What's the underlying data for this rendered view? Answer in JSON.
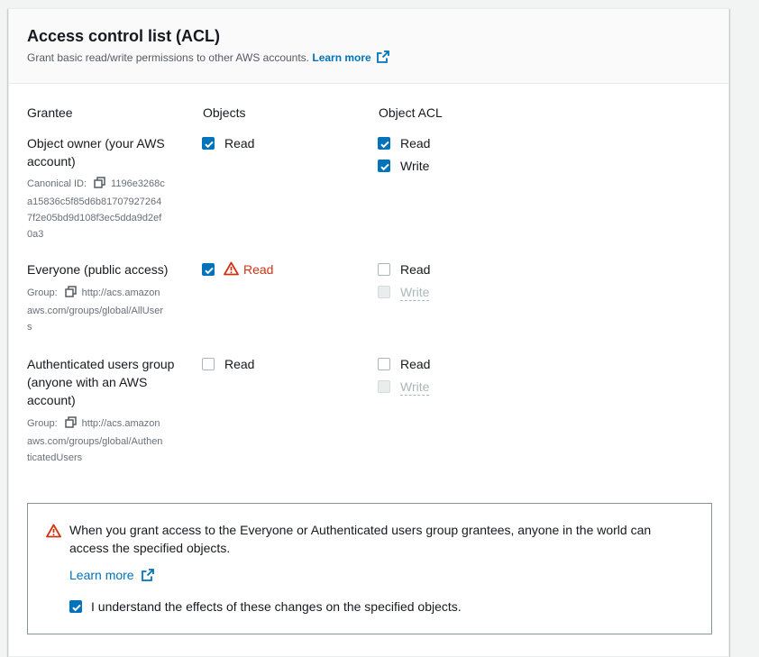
{
  "header": {
    "title": "Access control list (ACL)",
    "description": "Grant basic read/write permissions to other AWS accounts.",
    "learn_more": "Learn more"
  },
  "columns": {
    "grantee": "Grantee",
    "objects": "Objects",
    "object_acl": "Object ACL"
  },
  "grantees": [
    {
      "name": "Object owner (your AWS account)",
      "meta_label": "Canonical ID:",
      "meta_value_first": "1196e3268c",
      "meta_value_rest": [
        "a15836c5f85d6b81707927264",
        "7f2e05bd9d108f3ec5dda9d2ef",
        "0a3"
      ],
      "objects": {
        "label": "Read",
        "checked": true,
        "warning": false
      },
      "acl_read": {
        "label": "Read",
        "checked": true,
        "disabled": false
      },
      "acl_write": {
        "label": "Write",
        "checked": true,
        "disabled": false
      }
    },
    {
      "name": "Everyone (public access)",
      "meta_label": "Group:",
      "meta_value_first": "http://acs.amazon",
      "meta_value_rest": [
        "aws.com/groups/global/AllUser",
        "s"
      ],
      "objects": {
        "label": "Read",
        "checked": true,
        "warning": true
      },
      "acl_read": {
        "label": "Read",
        "checked": false,
        "disabled": false
      },
      "acl_write": {
        "label": "Write",
        "checked": false,
        "disabled": true
      }
    },
    {
      "name": "Authenticated users group (anyone with an AWS account)",
      "meta_label": "Group:",
      "meta_value_first": "http://acs.amazon",
      "meta_value_rest": [
        "aws.com/groups/global/Authen",
        "ticatedUsers"
      ],
      "objects": {
        "label": "Read",
        "checked": false,
        "warning": false
      },
      "acl_read": {
        "label": "Read",
        "checked": false,
        "disabled": false
      },
      "acl_write": {
        "label": "Write",
        "checked": false,
        "disabled": true
      }
    }
  ],
  "alert": {
    "message": "When you grant access to the Everyone or Authenticated users group grantees, anyone in the world can access the specified objects.",
    "learn_more": "Learn more",
    "acknowledge_label": "I understand the effects of these changes on the specified objects.",
    "acknowledge_checked": true
  },
  "colors": {
    "link": "#0073bb",
    "checkbox_checked": "#0073bb",
    "warning": "#d13212",
    "disabled": "#aab7b8"
  }
}
